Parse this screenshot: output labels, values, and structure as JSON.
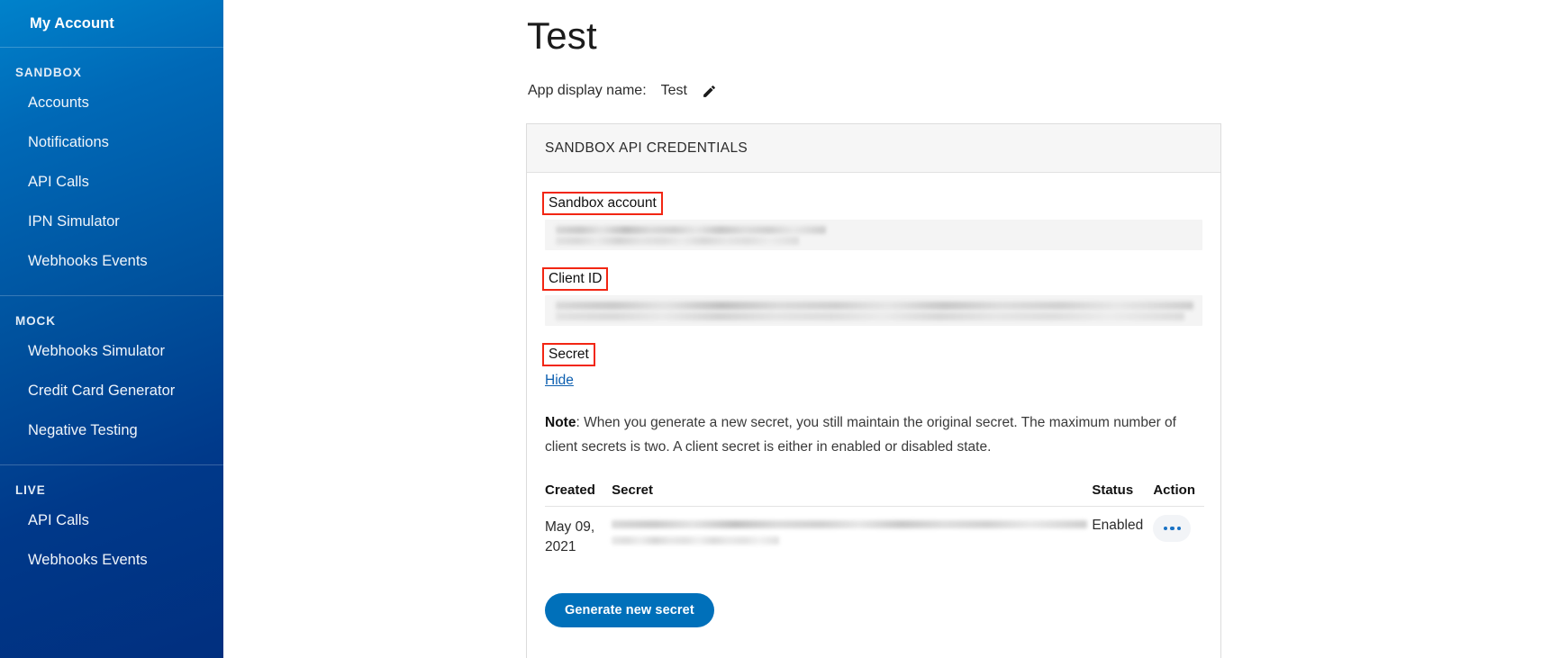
{
  "sidebar": {
    "top_item": {
      "label": "My Account"
    },
    "groups": [
      {
        "title": "SANDBOX",
        "items": [
          {
            "label": "Accounts"
          },
          {
            "label": "Notifications"
          },
          {
            "label": "API Calls"
          },
          {
            "label": "IPN Simulator"
          },
          {
            "label": "Webhooks Events"
          }
        ]
      },
      {
        "title": "MOCK",
        "items": [
          {
            "label": "Webhooks Simulator"
          },
          {
            "label": "Credit Card Generator"
          },
          {
            "label": "Negative Testing"
          }
        ]
      },
      {
        "title": "LIVE",
        "items": [
          {
            "label": "API Calls"
          },
          {
            "label": "Webhooks Events"
          }
        ]
      }
    ]
  },
  "main": {
    "page_title": "Test",
    "display_name_label": "App display name:",
    "display_name_value": "Test",
    "edit_icon": "pencil-icon"
  },
  "card": {
    "header": "SANDBOX API CREDENTIALS",
    "fields": [
      {
        "label": "Sandbox account",
        "value": "",
        "redacted": true,
        "annotated": true
      },
      {
        "label": "Client ID",
        "value": "",
        "redacted": true,
        "annotated": true
      },
      {
        "label": "Secret",
        "value": "",
        "redacted": false,
        "annotated": true
      }
    ],
    "hide_link": "Hide",
    "note_prefix": "Note",
    "note_text": ": When you generate a new secret, you still maintain the original secret. The maximum number of client secrets is two. A client secret is either in enabled or disabled state.",
    "table": {
      "headers": [
        "Created",
        "Secret",
        "Status",
        "Action"
      ],
      "rows": [
        {
          "created": "May 09, 2021",
          "secret": "",
          "status": "Enabled",
          "action_icon": "ellipsis-icon"
        }
      ]
    },
    "generate_button": "Generate new secret"
  },
  "colors": {
    "sidebar_top": "#0082cb",
    "sidebar_bottom": "#012f7f",
    "accent_blue": "#0070ba",
    "link_blue": "#0d5fb0",
    "annotation_red": "#f22613",
    "card_header_bg": "#f6f6f6"
  }
}
